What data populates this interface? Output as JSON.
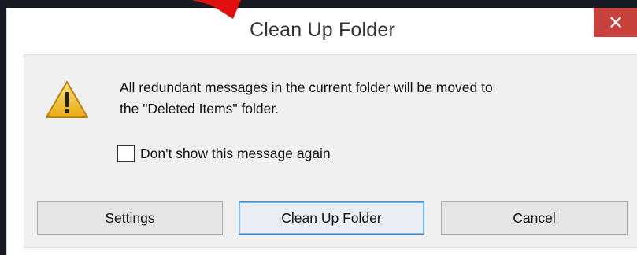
{
  "dialog": {
    "title": "Clean Up Folder",
    "close_label": "✕",
    "message_line1": "All redundant messages in the current folder will be moved to",
    "message_line2": "the \"Deleted Items\" folder.",
    "checkbox": {
      "label": "Don't show this message again",
      "checked": false
    },
    "buttons": {
      "settings": "Settings",
      "clean_up": "Clean Up Folder",
      "cancel": "Cancel"
    }
  },
  "colors": {
    "close_button": "#c9413c",
    "warning_fill": "#f2c230",
    "default_button_border": "#3c8fd6",
    "annotation_arrow": "#e01010"
  },
  "icons": {
    "warning": "warning-icon",
    "close": "close-icon",
    "annotation": "red-arrow-annotation"
  }
}
